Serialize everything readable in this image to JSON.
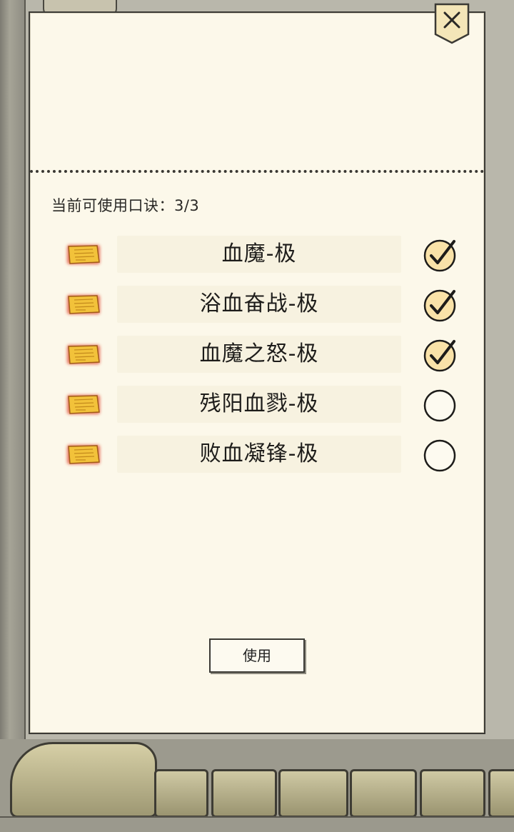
{
  "dialog": {
    "close_icon": "close-icon",
    "quota_label": "当前可使用口诀：3/3",
    "use_button_label": "使用"
  },
  "mantras": [
    {
      "name": "血魔-极",
      "selected": true
    },
    {
      "name": "浴血奋战-极",
      "selected": true
    },
    {
      "name": "血魔之怒-极",
      "selected": true
    },
    {
      "name": "残阳血戮-极",
      "selected": false
    },
    {
      "name": "败血凝锋-极",
      "selected": false
    }
  ],
  "colors": {
    "panel_background": "#fcf8ea",
    "token_gold": "#f2c23a",
    "token_glow": "#e0452a",
    "check_fill": "#f9e2a8",
    "ink": "#1d1c1a"
  }
}
